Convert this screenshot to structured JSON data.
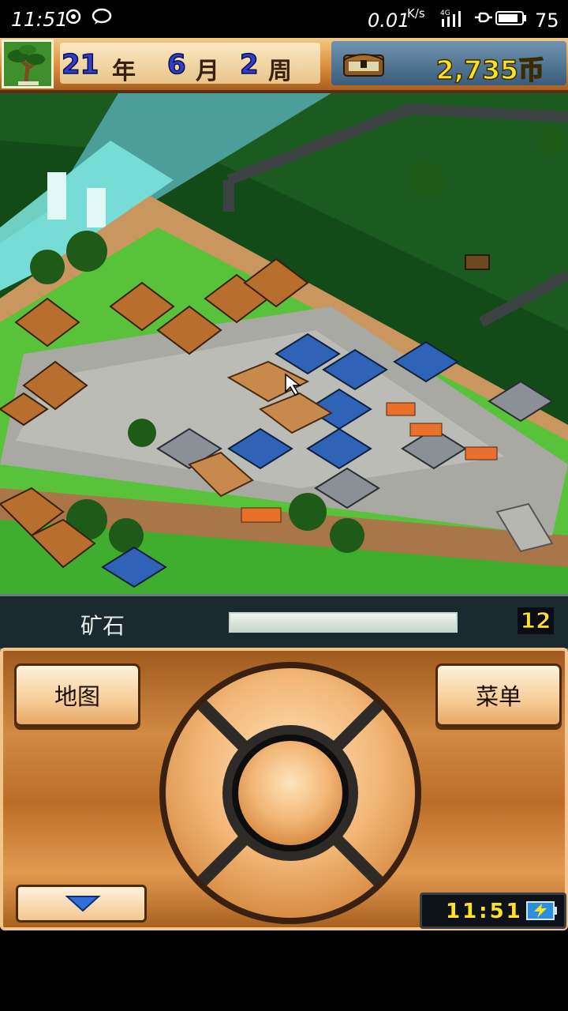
{
  "status_bar": {
    "time": "11:51",
    "speed_value": "0.01",
    "speed_unit": "K/s",
    "network": "4G",
    "battery_level": "75"
  },
  "hud": {
    "year_num": "21",
    "year_label": "年",
    "month_num": "6",
    "month_label": "月",
    "week_num": "2",
    "week_label": "周",
    "money": "2,735币"
  },
  "resource": {
    "label": "矿石",
    "fill_fraction": 1.0,
    "count": "12"
  },
  "controls": {
    "map_label": "地图",
    "menu_label": "菜单",
    "clock": "11:51"
  },
  "colors": {
    "accent_yellow": "#ffe21f",
    "date_blue": "#2f3fc8",
    "wood": "#d18a43"
  }
}
